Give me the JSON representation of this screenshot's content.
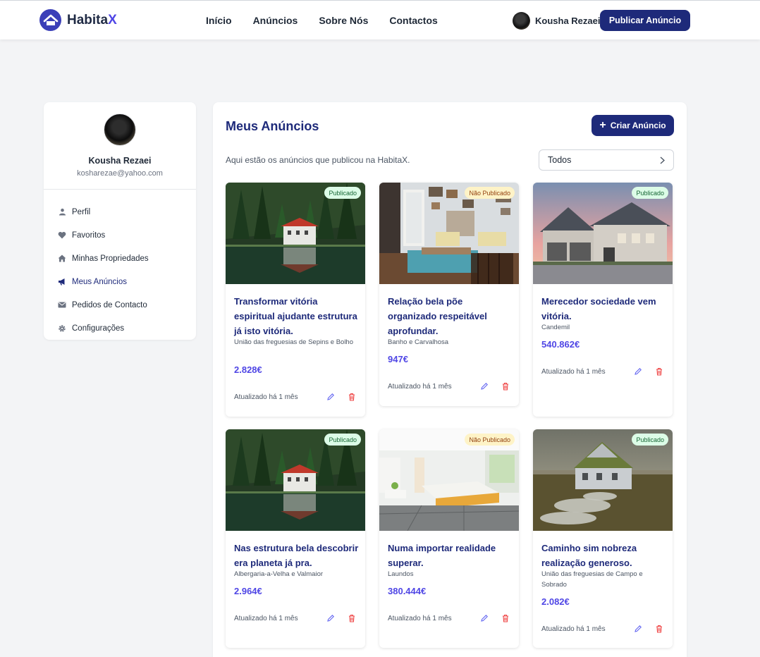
{
  "header": {
    "logo_main": "Habita",
    "logo_accent": "X",
    "nav": [
      "Início",
      "Anúncios",
      "Sobre Nós",
      "Contactos"
    ],
    "user_name": "Kousha Rezaei",
    "publish_label": "Publicar Anúncio"
  },
  "sidebar": {
    "name": "Kousha Rezaei",
    "email": "kosharezae@yahoo.com",
    "items": [
      {
        "label": "Perfil",
        "icon": "user-icon"
      },
      {
        "label": "Favoritos",
        "icon": "heart-icon"
      },
      {
        "label": "Minhas Propriedades",
        "icon": "home-icon"
      },
      {
        "label": "Meus Anúncios",
        "icon": "megaphone-icon",
        "active": true
      },
      {
        "label": "Pedidos de Contacto",
        "icon": "envelope-icon"
      },
      {
        "label": "Configurações",
        "icon": "gear-icon"
      }
    ]
  },
  "main": {
    "title": "Meus Anúncios",
    "create_label": "Criar Anúncio",
    "subtitle": "Aqui estão os anúncios que publicou na HabitaX.",
    "filter_value": "Todos"
  },
  "listings": [
    {
      "status": "Publicado",
      "title": "Transformar vitória espiritual ajudante estrutura já isto vitória.",
      "location": "União das freguesias de Sepins e Bolho",
      "price": "2.828€",
      "updated": "Atualizado há 1 mês"
    },
    {
      "status": "Não Publicado",
      "title": "Relação bela põe organizado respeitável aprofundar.",
      "location": "Banho e Carvalhosa",
      "price": "947€",
      "updated": "Atualizado há 1 mês"
    },
    {
      "status": "Publicado",
      "title": "Merecedor sociedade vem vitória.",
      "location": "Candemil",
      "price": "540.862€",
      "updated": "Atualizado há 1 mês"
    },
    {
      "status": "Publicado",
      "title": "Nas estrutura bela descobrir era planeta já pra.",
      "location": "Albergaria-a-Velha e Valmaior",
      "price": "2.964€",
      "updated": "Atualizado há 1 mês"
    },
    {
      "status": "Não Publicado",
      "title": "Numa importar realidade superar.",
      "location": "Laundos",
      "price": "380.444€",
      "updated": "Atualizado há 1 mês"
    },
    {
      "status": "Publicado",
      "title": "Caminho sim nobreza realização generoso.",
      "location": "União das freguesias de Campo e Sobrado",
      "price": "2.082€",
      "updated": "Atualizado há 1 mês"
    }
  ],
  "colors": {
    "brand_navy": "#1e2a7a",
    "accent_indigo": "#4f46e5",
    "published_bg": "#dcfce7",
    "unpublished_bg": "#fef3c7",
    "delete_red": "#ef4444"
  }
}
